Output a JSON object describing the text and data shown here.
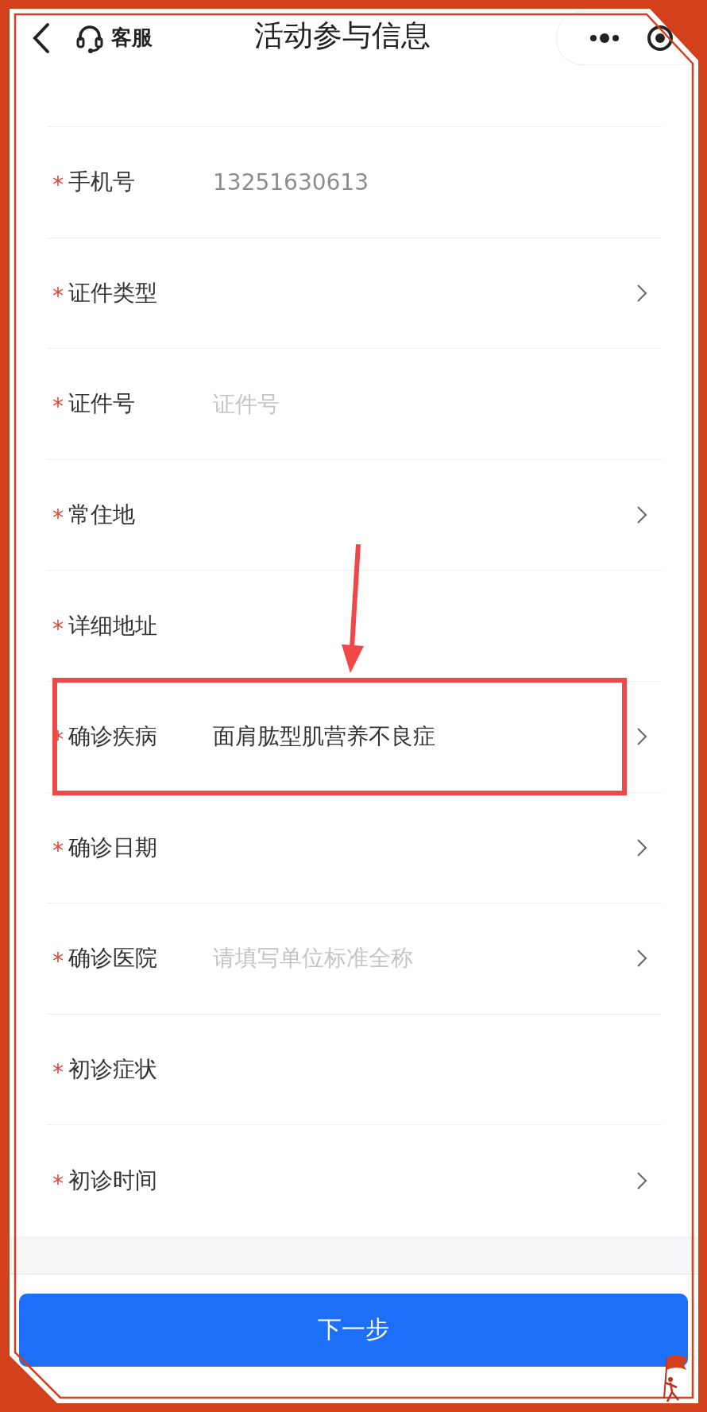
{
  "header": {
    "title": "活动参与信息",
    "service_label": "客服"
  },
  "required_mark": "*",
  "fields": [
    {
      "label": "手机号",
      "required": true,
      "kind": "input",
      "value": "13251630613",
      "disabled": true,
      "highlighted": false
    },
    {
      "label": "证件类型",
      "required": true,
      "kind": "select",
      "highlighted": false
    },
    {
      "label": "证件号",
      "required": true,
      "kind": "input",
      "placeholder": "证件号",
      "disabled": false,
      "highlighted": false
    },
    {
      "label": "常住地",
      "required": true,
      "kind": "select",
      "highlighted": false
    },
    {
      "label": "详细地址",
      "required": true,
      "kind": "input",
      "highlighted": false
    },
    {
      "label": "确诊疾病",
      "required": true,
      "kind": "select",
      "value": "面肩肱型肌营养不良症",
      "highlighted": true
    },
    {
      "label": "确诊日期",
      "required": true,
      "kind": "select",
      "highlighted": false
    },
    {
      "label": "确诊医院",
      "required": true,
      "kind": "select",
      "placeholder": "请填写单位标准全称",
      "highlighted": false
    },
    {
      "label": "初诊症状",
      "required": true,
      "kind": "input",
      "highlighted": false
    },
    {
      "label": "初诊时间",
      "required": true,
      "kind": "select",
      "highlighted": false
    }
  ],
  "next_button": "下一步"
}
